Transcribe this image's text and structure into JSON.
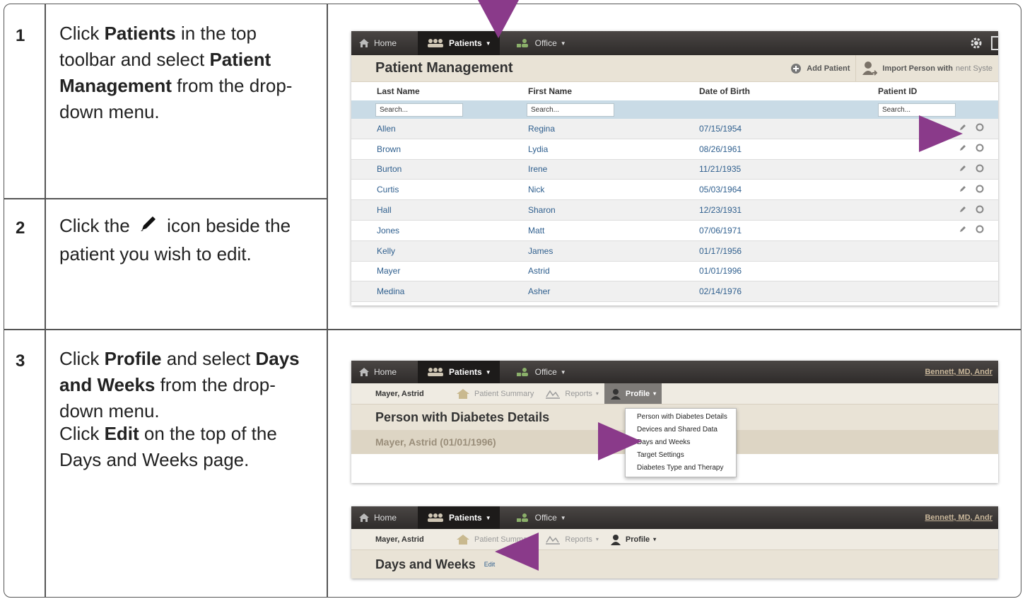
{
  "steps": [
    {
      "number": "1",
      "parts": [
        "Click ",
        "Patients",
        " in the top toolbar and select ",
        "Patient Management",
        " from the drop-down menu."
      ]
    },
    {
      "number": "2",
      "before": "Click the",
      "after": "icon beside the patient you wish to edit."
    },
    {
      "number": "3",
      "parts": [
        "Click ",
        "Profile",
        " and select ",
        "Days and Weeks",
        " from the drop-down menu."
      ],
      "parts2": [
        "Click ",
        "Edit",
        " on the top of the Days and Weeks page."
      ]
    }
  ],
  "nav": {
    "home": "Home",
    "patients": "Patients",
    "office": "Office",
    "user": "Bennett, MD, Andr"
  },
  "screen1": {
    "title": "Patient Management",
    "add_patient": "Add Patient",
    "import_person": "Import Person with",
    "import_suffix": "nent Syste",
    "columns": [
      "Last Name",
      "First Name",
      "Date of Birth",
      "Patient ID"
    ],
    "search_placeholder": "Search...",
    "rows": [
      {
        "last": "Allen",
        "first": "Regina",
        "dob": "07/15/1954",
        "actions": true
      },
      {
        "last": "Brown",
        "first": "Lydia",
        "dob": "08/26/1961",
        "actions": true
      },
      {
        "last": "Burton",
        "first": "Irene",
        "dob": "11/21/1935",
        "actions": true
      },
      {
        "last": "Curtis",
        "first": "Nick",
        "dob": "05/03/1964",
        "actions": true
      },
      {
        "last": "Hall",
        "first": "Sharon",
        "dob": "12/23/1931",
        "actions": true
      },
      {
        "last": "Jones",
        "first": "Matt",
        "dob": "07/06/1971",
        "actions": true
      },
      {
        "last": "Kelly",
        "first": "James",
        "dob": "01/17/1956",
        "actions": false
      },
      {
        "last": "Mayer",
        "first": "Astrid",
        "dob": "01/01/1996",
        "actions": false
      },
      {
        "last": "Medina",
        "first": "Asher",
        "dob": "02/14/1976",
        "actions": false
      }
    ]
  },
  "screen2": {
    "patient_name": "Mayer, Astrid",
    "patient_summary": "Patient Summary",
    "reports": "Reports",
    "profile": "Profile",
    "page_title": "Person with Diabetes Details",
    "patient_band": "Mayer, Astrid (01/01/1996)",
    "menu": [
      "Person with Diabetes Details",
      "Devices and Shared Data",
      "Days and Weeks",
      "Target Settings",
      "Diabetes Type and Therapy"
    ]
  },
  "screen3": {
    "patient_name": "Mayer, Astrid",
    "patient_summary": "Patient Summary",
    "reports": "Reports",
    "profile": "Profile",
    "page_title": "Days and Weeks",
    "edit": "Edit"
  },
  "colors": {
    "arrow": "#8a3a8a",
    "link": "#2f5f8e",
    "nav": "#2e2b2a"
  }
}
